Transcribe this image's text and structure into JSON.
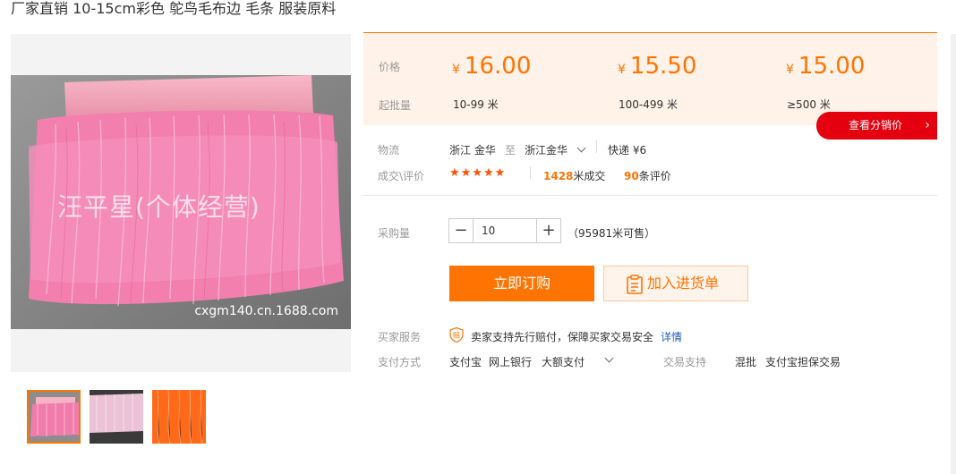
{
  "product": {
    "title": "厂家直销 10-15cm彩色 鸵鸟毛布边 毛条 服装原料",
    "image_watermark": "汪平星(个体经营)",
    "image_site": "cxgm140.cn.1688.com",
    "thumbnails": [
      "thumb-pink-fringe",
      "thumb-light-pink-fringe",
      "thumb-orange-fringe"
    ]
  },
  "pricing": {
    "price_label": "价格",
    "moq_label": "起批量",
    "currency": "¥",
    "tiers": [
      {
        "price": "16.00",
        "range": "10-99 米"
      },
      {
        "price": "15.50",
        "range": "100-499 米"
      },
      {
        "price": "15.00",
        "range": "≥500 米"
      }
    ],
    "dist_button": "查看分销价",
    "dist_arrow": "›"
  },
  "logistics": {
    "label": "物流",
    "from": "浙江 金华",
    "to_word": "至",
    "to": "浙江金华",
    "method": "快递 ¥6"
  },
  "reviews": {
    "label": "成交\\评价",
    "stars": "★★★★★",
    "sales_count": "1428",
    "sales_unit": "米成交",
    "review_count": "90",
    "review_unit": "条评价"
  },
  "purchase": {
    "label": "采购量",
    "minus": "−",
    "plus": "+",
    "quantity": "10",
    "available": "（95981米可售）",
    "buy_button": "立即订购",
    "cart_button": "加入进货单"
  },
  "service": {
    "label": "买家服务",
    "text": "卖家支持先行赔付，保障买家交易安全",
    "detail_link": "详情",
    "shield_glyph": "赔"
  },
  "payment": {
    "label": "支付方式",
    "methods": [
      "支付宝",
      "网上银行",
      "大额支付"
    ],
    "trade_label": "交易支持",
    "trade_options": [
      "混批",
      "支付宝担保交易"
    ]
  },
  "colors": {
    "accent": "#ff7300",
    "dist_red": "#e4000f",
    "price_bg": "#fff2e8",
    "link": "#1f5bbf"
  }
}
